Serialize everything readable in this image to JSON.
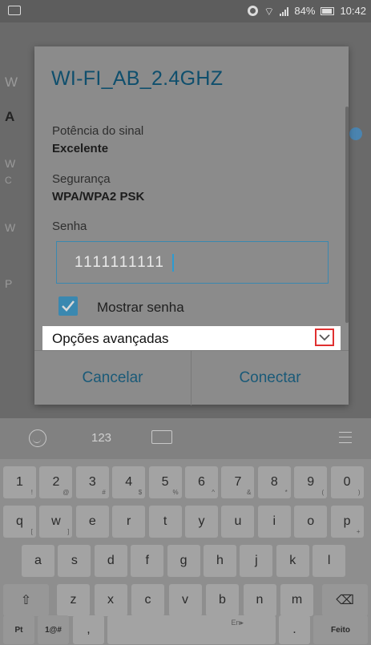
{
  "status_bar": {
    "battery": "84%",
    "time": "10:42"
  },
  "background_letters": [
    "W",
    "A",
    "W",
    "C",
    "W",
    "P"
  ],
  "dialog": {
    "title": "WI-FI_AB_2.4GHZ",
    "signal_label": "Potência do sinal",
    "signal_value": "Excelente",
    "security_label": "Segurança",
    "security_value": "WPA/WPA2 PSK",
    "password_label": "Senha",
    "password_value": "1111111111",
    "show_password_label": "Mostrar senha",
    "show_password_checked": true,
    "advanced_label": "Opções avançadas",
    "cancel_label": "Cancelar",
    "connect_label": "Conectar"
  },
  "keyboard": {
    "mode_label": "123",
    "row_numbers": [
      {
        "key": "1",
        "alt": "!"
      },
      {
        "key": "2",
        "alt": "@"
      },
      {
        "key": "3",
        "alt": "#"
      },
      {
        "key": "4",
        "alt": "$"
      },
      {
        "key": "5",
        "alt": "%"
      },
      {
        "key": "6",
        "alt": "^"
      },
      {
        "key": "7",
        "alt": "&"
      },
      {
        "key": "8",
        "alt": "*"
      },
      {
        "key": "9",
        "alt": "("
      },
      {
        "key": "0",
        "alt": ")"
      }
    ],
    "row_q": [
      {
        "key": "q",
        "alt": "["
      },
      {
        "key": "w",
        "alt": "]"
      },
      {
        "key": "e",
        "alt": ""
      },
      {
        "key": "r",
        "alt": ""
      },
      {
        "key": "t",
        "alt": ""
      },
      {
        "key": "y",
        "alt": ""
      },
      {
        "key": "u",
        "alt": ""
      },
      {
        "key": "i",
        "alt": ""
      },
      {
        "key": "o",
        "alt": ""
      },
      {
        "key": "p",
        "alt": "+"
      }
    ],
    "row_a": [
      "a",
      "s",
      "d",
      "f",
      "g",
      "h",
      "j",
      "k",
      "l"
    ],
    "row_z": [
      "z",
      "x",
      "c",
      "v",
      "b",
      "n",
      "m"
    ],
    "shift_icon": "⇧",
    "backspace_icon": "⌫",
    "lang_label": "Pt",
    "symbols_label": "1@#",
    "comma_label": ",",
    "period_label": ".",
    "space_hint": "En▸",
    "done_label": "Feito"
  }
}
